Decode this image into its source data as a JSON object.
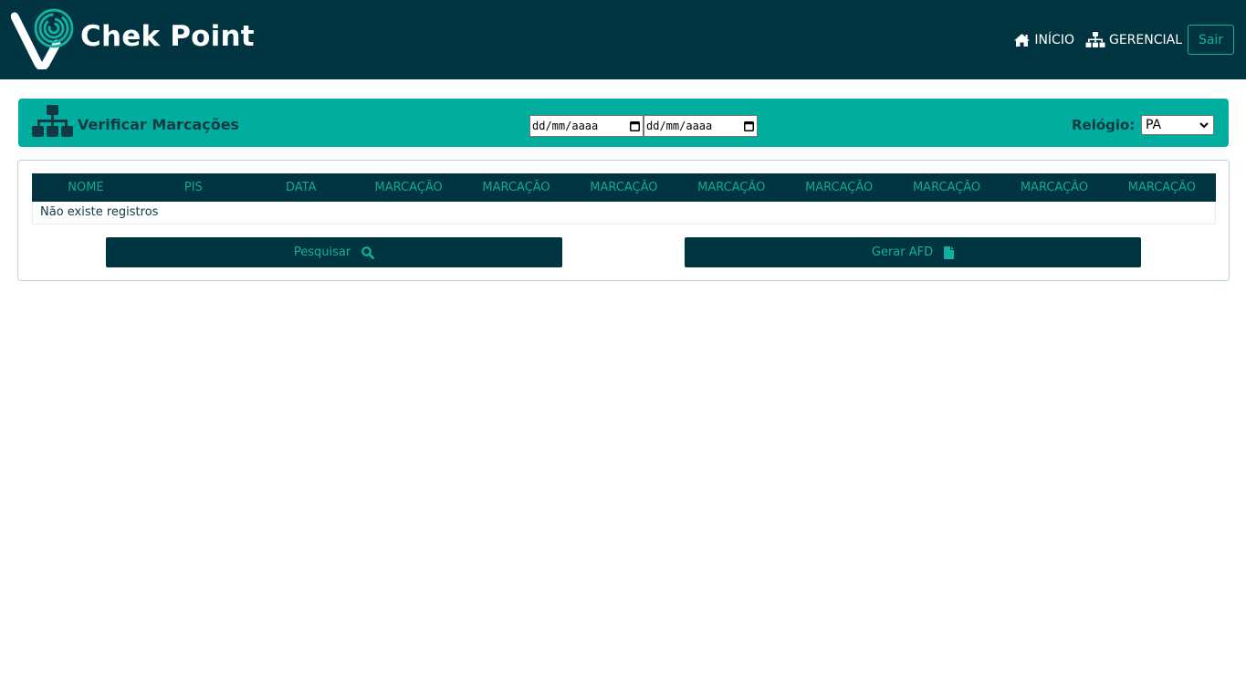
{
  "brand": {
    "name": "Chek Point",
    "logo_icon": "fingerprint-triangle-icon"
  },
  "nav": {
    "inicio": {
      "label": "INÍCIO",
      "icon": "home-icon"
    },
    "gerencial": {
      "label": "GERENCIAL",
      "icon": "sitemap-icon"
    },
    "sair_label": "Sair"
  },
  "panel": {
    "title": "Verificar Marcações",
    "icon": "sitemap-icon",
    "date_start": "dd/mm/aaaa",
    "date_end": "dd/mm/aaaa",
    "relogio_label": "Relógio:",
    "relogio_value": "PA"
  },
  "table": {
    "headers": [
      "NOME",
      "PIS",
      "DATA",
      "MARCAÇÃO",
      "MARCAÇÃO",
      "MARCAÇÃO",
      "MARCAÇÃO",
      "MARCAÇÃO",
      "MARCAÇÃO",
      "MARCAÇÃO",
      "MARCAÇÃO"
    ],
    "empty_message": "Não existe registros"
  },
  "actions": {
    "pesquisar": {
      "label": "Pesquisar",
      "icon": "search-icon"
    },
    "gerar_afd": {
      "label": "Gerar AFD",
      "icon": "file-icon"
    }
  },
  "colors": {
    "navbar": "#003440",
    "accent": "#00ad9e",
    "accent_text": "#12b0a0",
    "title_text": "#0f3a43"
  }
}
